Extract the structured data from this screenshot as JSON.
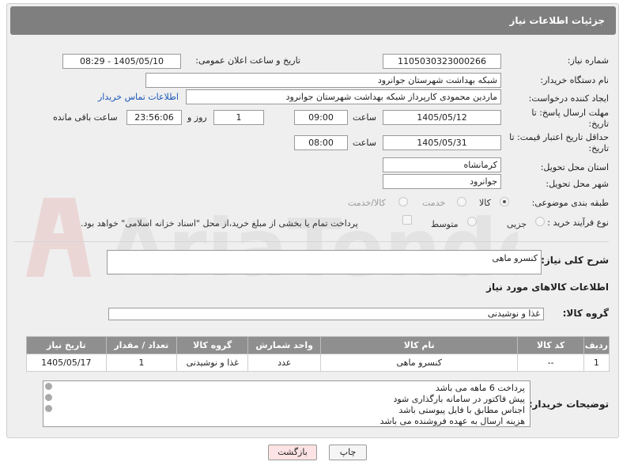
{
  "header": {
    "title": "جزئیات اطلاعات نیاز"
  },
  "fields": {
    "need_number_label": "شماره نیاز:",
    "need_number": "1105030323000266",
    "announce_label": "تاریخ و ساعت اعلان عمومی:",
    "announce_value": "1405/05/10 - 08:29",
    "buyer_org_label": "نام دستگاه خریدار:",
    "buyer_org": "شبکه بهداشت شهرستان جوانرود",
    "creator_label": "ایجاد کننده درخواست:",
    "creator": "ماردین محمودی کارپرداز شبکه بهداشت شهرستان جوانرود",
    "contact_link": "اطلاعات تماس خریدار",
    "deadline_label": "مهلت ارسال پاسخ: تا تاریخ:",
    "deadline_date": "1405/05/12",
    "time_label": "ساعت",
    "deadline_time": "09:00",
    "days_value": "1",
    "days_label": "روز و",
    "remaining_time": "23:56:06",
    "remaining_label": "ساعت باقی مانده",
    "validity_label": "حداقل تاریخ اعتبار قیمت: تا تاریخ:",
    "validity_date": "1405/05/31",
    "validity_time": "08:00",
    "province_label": "استان محل تحویل:",
    "province": "کرمانشاه",
    "city_label": "شهر محل تحویل:",
    "city": "جوانرود",
    "category_label": "طبقه بندی موضوعی:",
    "category_options": [
      "کالا",
      "خدمت",
      "کالا/خدمت"
    ],
    "process_label": "نوع فرآیند خرید :",
    "process_options": [
      "جزیی",
      "متوسط"
    ],
    "payment_text": "پرداخت تمام یا بخشی از مبلغ خرید،از محل \"اسناد خزانه اسلامی\" خواهد بود."
  },
  "description": {
    "label": "شرح کلی نیاز:",
    "value": "کنسرو ماهی"
  },
  "goods": {
    "section_title": "اطلاعات کالاهای مورد نیاز",
    "group_label": "گروه کالا:",
    "group_value": "غذا و نوشیدنی"
  },
  "table": {
    "headers": [
      "ردیف",
      "کد کالا",
      "نام کالا",
      "واحد شمارش",
      "گروه کالا",
      "تعداد / مقدار",
      "تاریخ نیاز"
    ],
    "rows": [
      [
        "1",
        "--",
        "کنسرو ماهی",
        "عدد",
        "غذا و نوشیدنی",
        "1",
        "1405/05/17"
      ]
    ]
  },
  "notes": {
    "label": "توضیحات خریدار:",
    "lines": [
      "پرداخت 6 ماهه می باشد",
      "پیش فاکتور در سامانه بارگذاری شود",
      "اجناس مطابق با فایل پیوستی باشد",
      "هزینه ارسال به عهده فروشنده می باشد"
    ]
  },
  "buttons": {
    "print": "چاپ",
    "back": "بازگشت"
  },
  "watermark": "AriaTender.neT",
  "colors": {
    "header": "#7f7f7f",
    "table_header": "#8f8f8f",
    "link": "#1a57b8",
    "back_button": "#fde3e3"
  }
}
